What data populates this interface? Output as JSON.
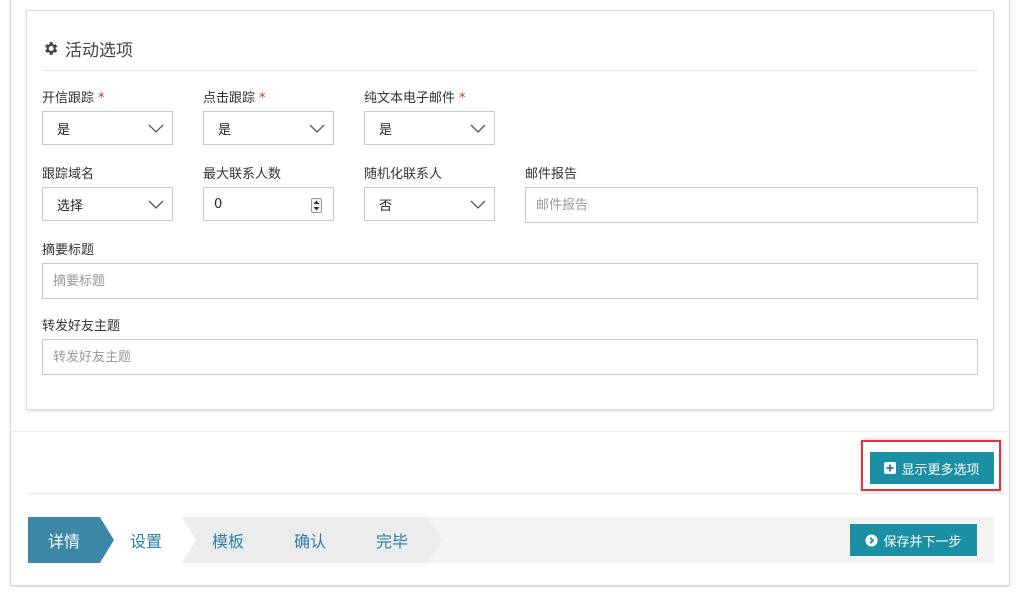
{
  "panel": {
    "title": "活动选项",
    "icon": "gear-icon"
  },
  "form": {
    "open_tracking": {
      "label": "开信跟踪",
      "value": "是"
    },
    "click_tracking": {
      "label": "点击跟踪",
      "value": "是"
    },
    "plain_text_email": {
      "label": "纯文本电子邮件",
      "value": "是"
    },
    "tracking_domain": {
      "label": "跟踪域名",
      "value": "选择"
    },
    "max_contacts": {
      "label": "最大联系人数",
      "value": "0"
    },
    "randomize_contacts": {
      "label": "随机化联系人",
      "value": "否"
    },
    "email_report": {
      "label": "邮件报告",
      "placeholder": "邮件报告"
    },
    "summary_title": {
      "label": "摘要标题",
      "placeholder": "摘要标题"
    },
    "forward_subject": {
      "label": "转发好友主题",
      "placeholder": "转发好友主题"
    },
    "required_mark": "*"
  },
  "actions": {
    "show_more": "显示更多选项",
    "save_next": "保存并下一步"
  },
  "wizard": {
    "steps": [
      "详情",
      "设置",
      "模板",
      "确认",
      "完毕"
    ],
    "active_index": 0
  },
  "colors": {
    "accent": "#1b8fa3",
    "wizard_active": "#3c86a6",
    "required": "#c0392b",
    "highlight": "#d9363e"
  }
}
